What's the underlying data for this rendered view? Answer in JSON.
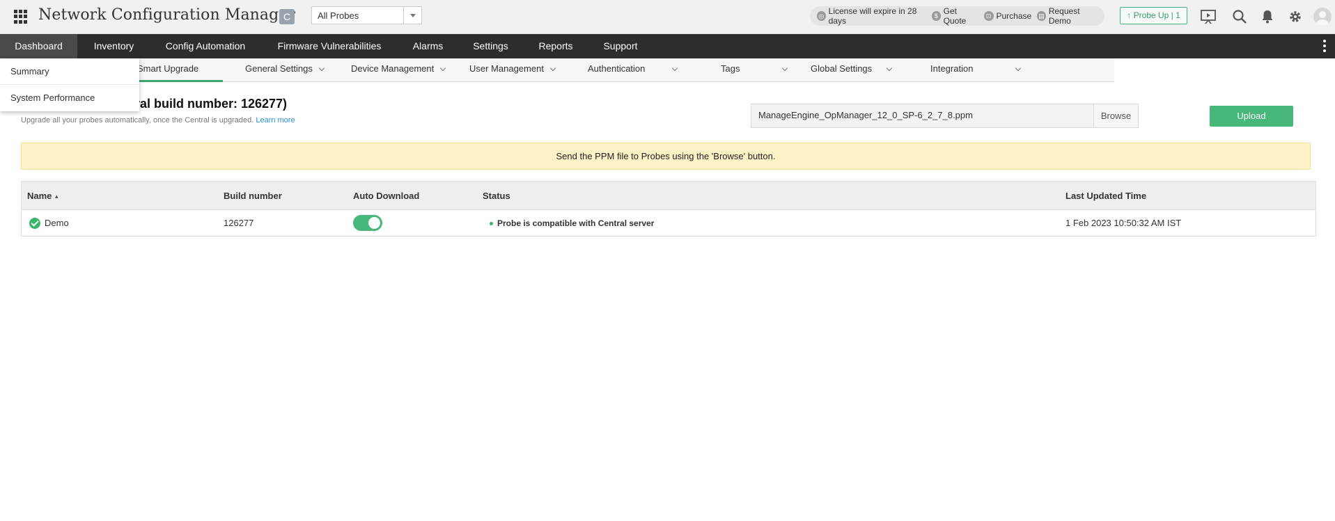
{
  "header": {
    "app_title": "Network Configuration Manager",
    "badge": "C",
    "probe_select": {
      "value": "All Probes"
    },
    "license_items": [
      {
        "label": "License will expire in 28 days",
        "icon": "license-icon"
      },
      {
        "label": "Get Quote",
        "icon": "quote-icon"
      },
      {
        "label": "Purchase",
        "icon": "cart-icon"
      },
      {
        "label": "Request Demo",
        "icon": "demo-icon"
      }
    ],
    "probe_up": "↑ Probe Up | 1"
  },
  "main_nav": [
    "Dashboard",
    "Inventory",
    "Config Automation",
    "Firmware Vulnerabilities",
    "Alarms",
    "Settings",
    "Reports",
    "Support"
  ],
  "sub_nav": [
    "Smart Upgrade",
    "General Settings",
    "Device Management",
    "User Management",
    "Authentication",
    "Tags",
    "Global Settings",
    "Integration"
  ],
  "dropdown": [
    "Summary",
    "System Performance"
  ],
  "page": {
    "title_visible": "ntral build number: 126277)",
    "subtitle": "Upgrade all your probes automatically, once the Central is upgraded.",
    "learn_more": "Learn more",
    "file_name": "ManageEngine_OpManager_12_0_SP-6_2_7_8.ppm",
    "browse_label": "Browse",
    "upload_label": "Upload",
    "banner": "Send the PPM file to Probes using the 'Browse' button."
  },
  "table": {
    "headers": [
      "Name",
      "Build number",
      "Auto Download",
      "Status",
      "Last Updated Time"
    ],
    "rows": [
      {
        "name": "Demo",
        "build": "126277",
        "auto_download": true,
        "status": "Probe is compatible with Central server",
        "last_updated": "1 Feb 2023 10:50:32 AM IST"
      }
    ]
  },
  "colors": {
    "accent": "#47b87a",
    "nav_bg": "#2d2d2d",
    "banner_bg": "#fdf3c6",
    "link": "#2a8fd6"
  }
}
